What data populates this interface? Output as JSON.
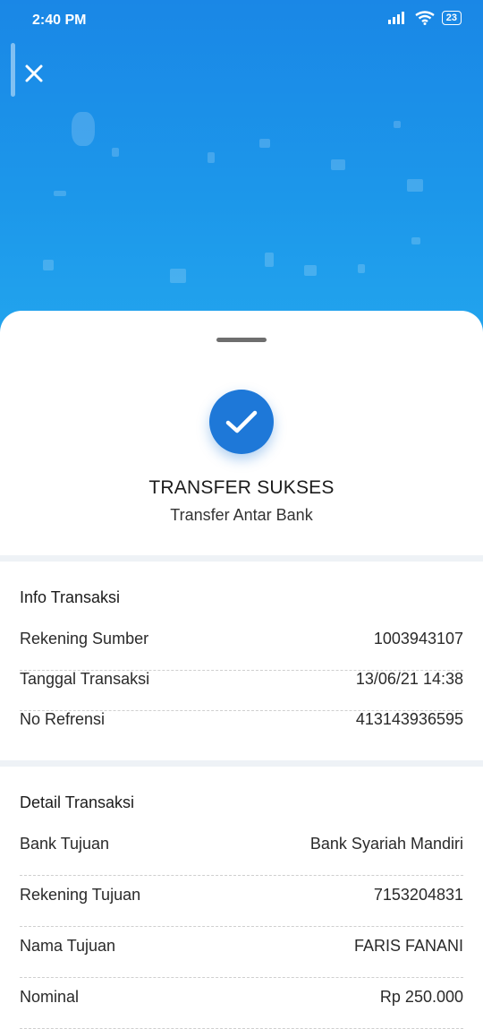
{
  "status_bar": {
    "time": "2:40 PM",
    "battery": "23"
  },
  "colors": {
    "hero": "#1c97ea",
    "check": "#1e78d8"
  },
  "icons": {
    "close": "close-icon",
    "check": "check-icon",
    "wifi": "wifi-icon",
    "signal": "signal-icon"
  },
  "result": {
    "title": "TRANSFER SUKSES",
    "subtitle": "Transfer Antar Bank"
  },
  "info": {
    "title": "Info Transaksi",
    "rows": [
      {
        "label": "Rekening Sumber",
        "value": "1003943107"
      },
      {
        "label": "Tanggal Transaksi",
        "value": "13/06/21 14:38"
      },
      {
        "label": "No Refrensi",
        "value": "413143936595"
      }
    ]
  },
  "detail": {
    "title": "Detail Transaksi",
    "rows": [
      {
        "label": "Bank Tujuan",
        "value": "Bank Syariah Mandiri"
      },
      {
        "label": "Rekening Tujuan",
        "value": "7153204831"
      },
      {
        "label": "Nama Tujuan",
        "value": "FARIS FANANI"
      },
      {
        "label": "Nominal",
        "value": "Rp 250.000"
      }
    ]
  }
}
